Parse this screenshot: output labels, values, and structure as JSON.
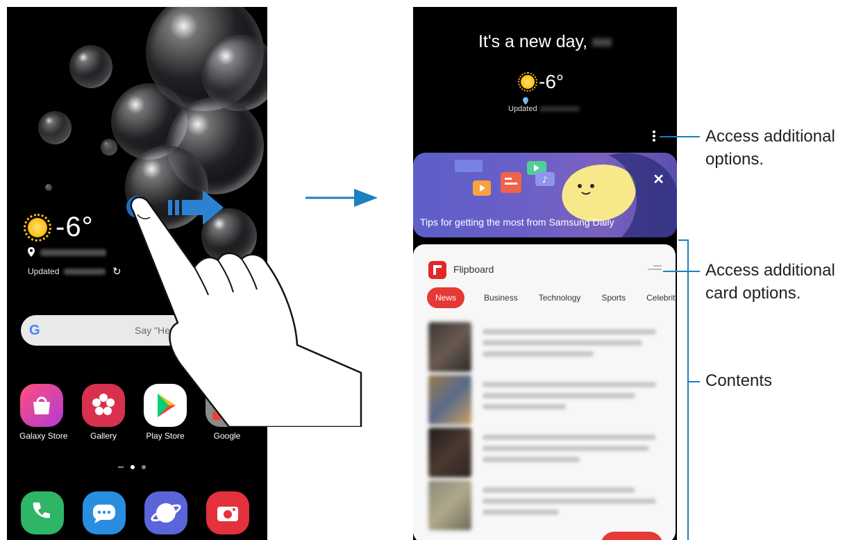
{
  "left_phone": {
    "weather": {
      "temperature": "-6°",
      "updated_label": "Updated"
    },
    "search": {
      "hint": "Say \"Hey G"
    },
    "apps": [
      {
        "label": "Galaxy Store"
      },
      {
        "label": "Gallery"
      },
      {
        "label": "Play Store"
      },
      {
        "label": "Google"
      }
    ]
  },
  "right_phone": {
    "greeting": "It's a new day,",
    "weather": {
      "temperature": "-6°",
      "updated_label": "Updated"
    },
    "tip_card": {
      "text": "Tips for getting the most from Samsung Daily",
      "close_glyph": "✕"
    },
    "flipboard": {
      "title": "Flipboard",
      "tabs": [
        "News",
        "Business",
        "Technology",
        "Sports",
        "Celebrity"
      ]
    }
  },
  "callouts": {
    "more_options": "Access additional options.",
    "card_options": "Access additional card options.",
    "contents": "Contents"
  },
  "colors": {
    "callout_line": "#1b7fc0",
    "flipboard_red": "#e53935",
    "tip_card": "#6a5fc7"
  }
}
